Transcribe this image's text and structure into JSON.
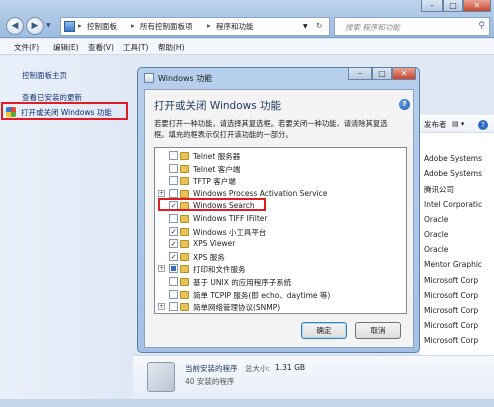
{
  "explorer": {
    "breadcrumbs": [
      "控制面板",
      "所有控制面板项",
      "程序和功能"
    ],
    "search_placeholder": "搜索 程序和功能",
    "menu": [
      "文件(F)",
      "编辑(E)",
      "查看(V)",
      "工具(T)",
      "帮助(H)"
    ],
    "left_links": [
      "控制面板主页",
      "查看已安装的更新",
      "打开或关闭 Windows 功能"
    ],
    "publisher_header": "发布者",
    "publishers": [
      "Adobe Systems",
      "Adobe Systems",
      "腾讯公司",
      "Intel Corporatic",
      "Oracle",
      "Oracle",
      "Oracle",
      "Mentor Graphic",
      "Microsoft Corp",
      "Microsoft Corp",
      "Microsoft Corp",
      "Microsoft Corp",
      "Microsoft Corp"
    ],
    "installed_title": "当前安装的程序",
    "installed_total_label": "总大小:",
    "installed_total": "1.31 GB",
    "installed_count": "40 安装的程序"
  },
  "dialog": {
    "title": "Windows 功能",
    "heading": "打开或关闭 Windows 功能",
    "description": [
      "若要打开一种功能，请选择其复选框。若要关闭一种功能，请清除其复选",
      "框。填充的框表示仅打开该功能的一部分。"
    ],
    "features": [
      {
        "label": "Telnet 服务器",
        "state": "off",
        "expandable": false
      },
      {
        "label": "Telnet 客户端",
        "state": "off",
        "expandable": false
      },
      {
        "label": "TFTP 客户端",
        "state": "off",
        "expandable": false
      },
      {
        "label": "Windows Process Activation Service",
        "state": "off",
        "expandable": true
      },
      {
        "label": "Windows Search",
        "state": "on",
        "expandable": false
      },
      {
        "label": "Windows TIFF IFilter",
        "state": "off",
        "expandable": false
      },
      {
        "label": "Windows 小工具平台",
        "state": "on",
        "expandable": false
      },
      {
        "label": "XPS Viewer",
        "state": "on",
        "expandable": false
      },
      {
        "label": "XPS 服务",
        "state": "on",
        "expandable": false
      },
      {
        "label": "打印和文件服务",
        "state": "partial",
        "expandable": true
      },
      {
        "label": "基于 UNIX 的应用程序子系统",
        "state": "off",
        "expandable": false
      },
      {
        "label": "简单 TCPIP 服务(即 echo、daytime 等)",
        "state": "off",
        "expandable": false
      },
      {
        "label": "简单网络管理协议(SNMP)",
        "state": "off",
        "expandable": true
      }
    ],
    "ok_label": "确定",
    "cancel_label": "取消"
  }
}
